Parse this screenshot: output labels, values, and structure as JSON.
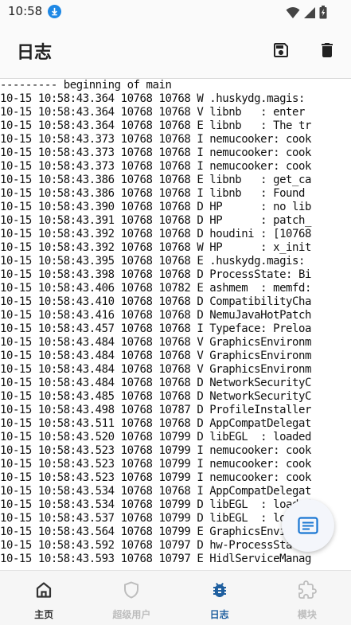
{
  "status_bar": {
    "time": "10:58"
  },
  "app_bar": {
    "title": "日志"
  },
  "log_lines": [
    "--------- beginning of main",
    "10-15 10:58:43.364 10768 10768 W .huskydg.magis:",
    "10-15 10:58:43.364 10768 10768 V libnb   : enter",
    "10-15 10:58:43.364 10768 10768 E libnb   : The tr",
    "10-15 10:58:43.373 10768 10768 I nemucooker: cook",
    "10-15 10:58:43.373 10768 10768 I nemucooker: cook",
    "10-15 10:58:43.373 10768 10768 I nemucooker: cook",
    "10-15 10:58:43.386 10768 10768 E libnb   : get_ca",
    "10-15 10:58:43.386 10768 10768 I libnb   : Found",
    "10-15 10:58:43.390 10768 10768 D HP      : no lib",
    "10-15 10:58:43.391 10768 10768 D HP      : patch_",
    "10-15 10:58:43.392 10768 10768 D houdini : [10768",
    "10-15 10:58:43.392 10768 10768 W HP      : x_init",
    "10-15 10:58:43.395 10768 10768 E .huskydg.magis:",
    "10-15 10:58:43.398 10768 10768 D ProcessState: Bi",
    "10-15 10:58:43.406 10768 10782 E ashmem  : memfd:",
    "10-15 10:58:43.410 10768 10768 D CompatibilityCha",
    "10-15 10:58:43.416 10768 10768 D NemuJavaHotPatch",
    "10-15 10:58:43.457 10768 10768 I Typeface: Preloa",
    "10-15 10:58:43.484 10768 10768 V GraphicsEnvironm",
    "10-15 10:58:43.484 10768 10768 V GraphicsEnvironm",
    "10-15 10:58:43.484 10768 10768 V GraphicsEnvironm",
    "10-15 10:58:43.484 10768 10768 D NetworkSecurityC",
    "10-15 10:58:43.485 10768 10768 D NetworkSecurityC",
    "10-15 10:58:43.498 10768 10787 D ProfileInstaller",
    "10-15 10:58:43.511 10768 10768 D AppCompatDelegat",
    "10-15 10:58:43.520 10768 10799 D libEGL  : loaded",
    "10-15 10:58:43.523 10768 10799 I nemucooker: cook",
    "10-15 10:58:43.523 10768 10799 I nemucooker: cook",
    "10-15 10:58:43.523 10768 10799 I nemucooker: cook",
    "10-15 10:58:43.534 10768 10768 I AppCompatDelegat",
    "10-15 10:58:43.534 10768 10799 D libEGL  : loaded",
    "10-15 10:58:43.537 10768 10799 D libEGL  : loaded",
    "10-15 10:58:43.564 10768 10799 E GraphicsEnvironm",
    "10-15 10:58:43.592 10768 10797 D hw-ProcessState:",
    "10-15 10:58:43.593 10768 10797 E HidlServiceManag"
  ],
  "nav": {
    "items": [
      {
        "label": "主页",
        "icon": "home-icon",
        "active": false,
        "enabled": true
      },
      {
        "label": "超级用户",
        "icon": "shield-icon",
        "active": false,
        "enabled": false
      },
      {
        "label": "日志",
        "icon": "bug-icon",
        "active": true,
        "enabled": true
      },
      {
        "label": "模块",
        "icon": "puzzle-icon",
        "active": false,
        "enabled": false
      }
    ]
  },
  "colors": {
    "accent": "#1f5f9f",
    "nav_active": "#1f5f9f",
    "nav_inactive": "#333333",
    "nav_disabled": "#bdbdbd",
    "fab_icon": "#1976d2"
  }
}
